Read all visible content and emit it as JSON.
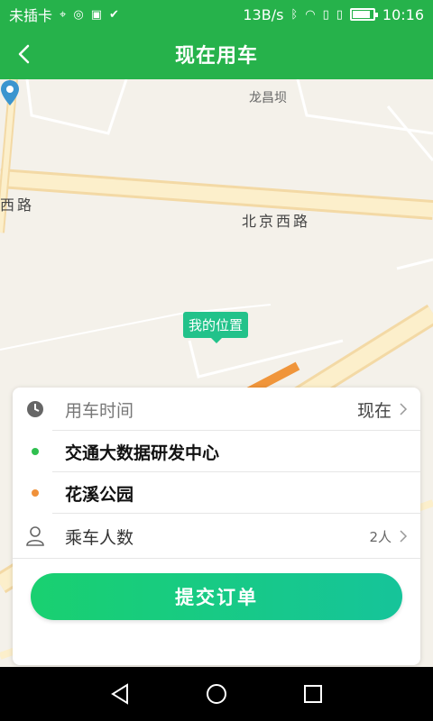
{
  "status_bar": {
    "carrier": "未插卡",
    "network_speed": "13B/s",
    "time": "10:16"
  },
  "nav": {
    "title": "现在用车"
  },
  "map": {
    "place_label": "龙昌坝",
    "road_left": "西路",
    "road_main": "北京西路",
    "my_location": "我的位置"
  },
  "form": {
    "time_label": "用车时间",
    "time_value": "现在",
    "origin": "交通大数据研发中心",
    "destination": "花溪公园",
    "passengers_label": "乘车人数",
    "passengers_value": "2人",
    "submit_label": "提交订单"
  },
  "colors": {
    "brand_green": "#26b24b",
    "origin_dot": "#2fbf4f",
    "destination_dot": "#f0913a",
    "submit_gradient_start": "#19d070",
    "submit_gradient_end": "#16c49a"
  }
}
